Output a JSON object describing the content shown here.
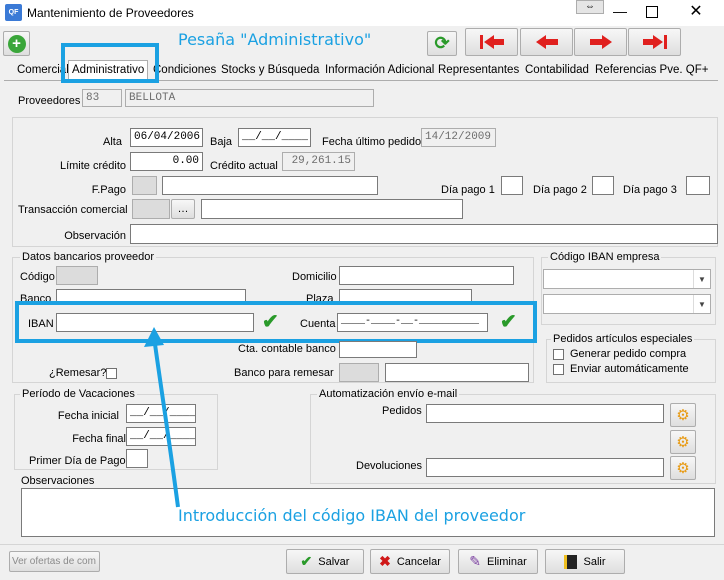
{
  "window": {
    "title": "Mantenimiento de Proveedores",
    "app_icon_text": "QF"
  },
  "annotations": {
    "tab_note": "Pesaña \"Administrativo\"",
    "iban_note": "Introducción del código IBAN del proveedor"
  },
  "tabs": [
    "Comercial",
    "Administrativo",
    "Condiciones",
    "Stocks y Búsqueda",
    "Información Adicional",
    "Representantes",
    "Contabilidad",
    "Referencias Pve. QF+"
  ],
  "provider": {
    "label": "Proveedores",
    "code": "83",
    "name": "BELLOTA"
  },
  "admin": {
    "alta_label": "Alta",
    "alta": "06/04/2006",
    "baja_label": "Baja",
    "baja": "__/__/____",
    "fecha_ultimo_label": "Fecha último pedido",
    "fecha_ultimo": "14/12/2009",
    "limite_label": "Límite crédito",
    "limite": "0.00",
    "credito_actual_label": "Crédito actual",
    "credito_actual": "29,261.15",
    "fpago_label": "F.Pago",
    "dia1_label": "Día pago 1",
    "dia2_label": "Día pago 2",
    "dia3_label": "Día pago 3",
    "transaccion_label": "Transacción comercial",
    "observacion_label": "Observación"
  },
  "banco": {
    "title": "Datos bancarios proveedor",
    "codigo_label": "Código",
    "domicilio_label": "Domicilio",
    "banco_label": "Banco",
    "plaza_label": "Plaza",
    "iban_label": "IBAN",
    "iban": "",
    "cuenta_label": "Cuenta",
    "cuenta": "____-____-__-__________",
    "cta_contable_label": "Cta. contable banco",
    "remesar_label": "¿Remesar?",
    "banco_remesar_label": "Banco para remesar"
  },
  "iban_empresa": {
    "title": "Código IBAN empresa"
  },
  "pedidos_especiales": {
    "title": "Pedidos artículos especiales",
    "generar_label": "Generar pedido compra",
    "enviar_label": "Enviar automáticamente"
  },
  "vacaciones": {
    "title": "Período de Vacaciones",
    "inicial_label": "Fecha inicial",
    "inicial": "__/__/____",
    "final_label": "Fecha final",
    "final": "__/__/____",
    "primer_dia_label": "Primer Día de Pago"
  },
  "email": {
    "title": "Automatización envío e-mail",
    "pedidos_label": "Pedidos",
    "devoluciones_label": "Devoluciones"
  },
  "observaciones": {
    "label": "Observaciones"
  },
  "footer": {
    "ver_ofertas": "Ver ofertas de com",
    "salvar": "Salvar",
    "cancelar": "Cancelar",
    "eliminar": "Eliminar",
    "salir": "Salir"
  },
  "colors": {
    "annotation": "#1ba1e2",
    "nav_red": "#e0201e",
    "ok_green": "#2a9a2a"
  }
}
